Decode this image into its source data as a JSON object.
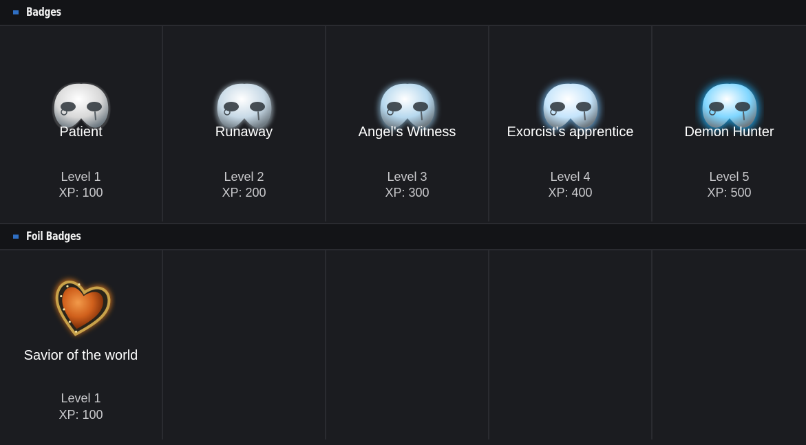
{
  "badges_section": {
    "title": "Badges",
    "items": [
      {
        "name": "Patient",
        "level": "Level 1",
        "xp": "XP: 100",
        "icon": "mask-icon",
        "tint": "#d8d8d8",
        "glow": "#ffffff"
      },
      {
        "name": "Runaway",
        "level": "Level 2",
        "xp": "XP: 200",
        "icon": "mask-icon",
        "tint": "#c7d9e6",
        "glow": "#cfe3ef"
      },
      {
        "name": "Angel's Witness",
        "level": "Level 3",
        "xp": "XP: 300",
        "icon": "mask-icon",
        "tint": "#b6d8ee",
        "glow": "#9fd0f0"
      },
      {
        "name": "Exorcist's apprentice",
        "level": "Level 4",
        "xp": "XP: 400",
        "icon": "mask-icon",
        "tint": "#c4e4fb",
        "glow": "#7cc6ff"
      },
      {
        "name": "Demon Hunter",
        "level": "Level 5",
        "xp": "XP: 500",
        "icon": "mask-icon",
        "tint": "#7fd6ff",
        "glow": "#22b6ff"
      }
    ]
  },
  "foil_section": {
    "title": "Foil Badges",
    "items": [
      {
        "name": "Savior of the world",
        "level": "Level 1",
        "xp": "XP: 100",
        "icon": "heart-icon",
        "tint": "#d9681f",
        "glow": "#ff8a1a"
      }
    ]
  },
  "colors": {
    "background": "#1b1c20",
    "header": "#131417",
    "accent": "#2f6fc4"
  }
}
